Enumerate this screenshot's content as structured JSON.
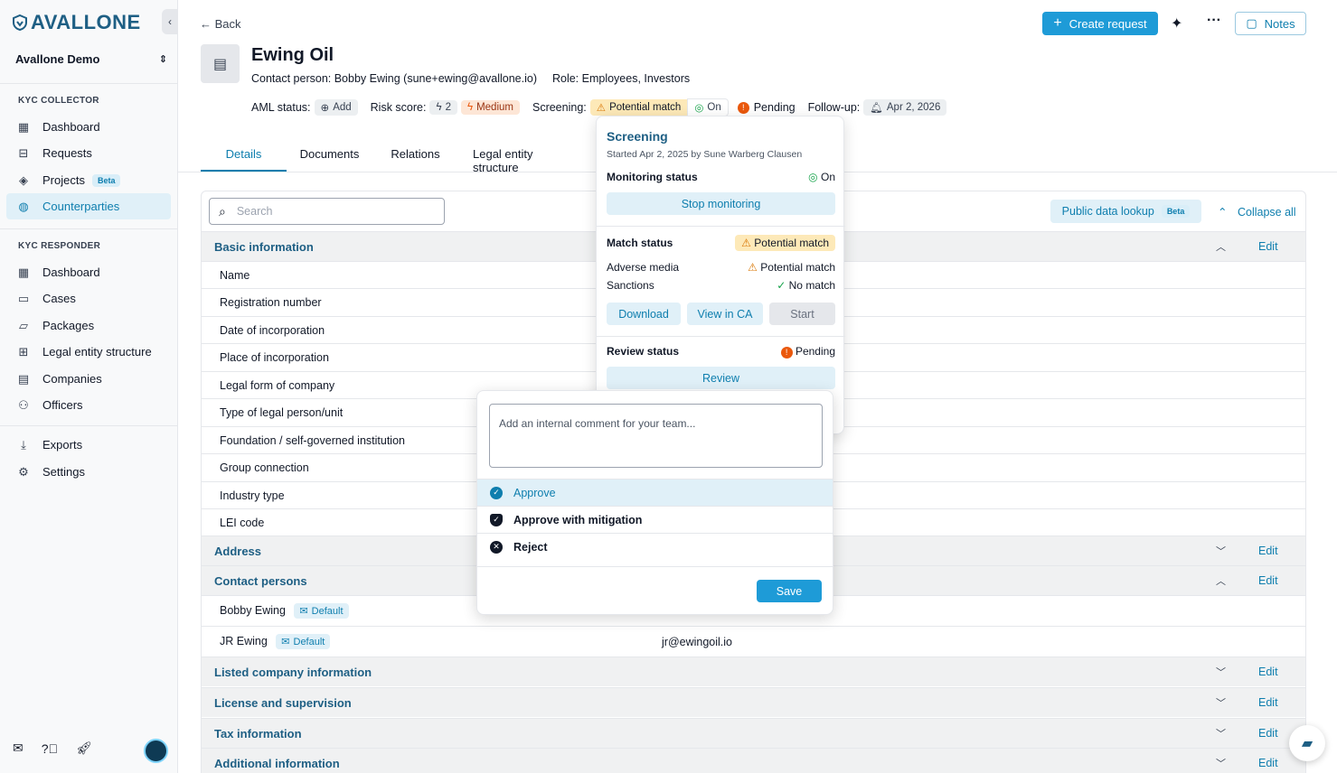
{
  "app": {
    "logo_text": "AVALLONE",
    "org_name": "Avallone Demo"
  },
  "sidebar": {
    "collector_label": "KYC COLLECTOR",
    "collector_items": [
      {
        "label": "Dashboard",
        "icon": "grid-icon"
      },
      {
        "label": "Requests",
        "icon": "inbox-icon"
      },
      {
        "label": "Projects",
        "icon": "layers-icon",
        "badge": "Beta"
      },
      {
        "label": "Counterparties",
        "icon": "globe-icon",
        "active": true
      }
    ],
    "responder_label": "KYC RESPONDER",
    "responder_items": [
      {
        "label": "Dashboard",
        "icon": "grid-icon"
      },
      {
        "label": "Cases",
        "icon": "briefcase-icon"
      },
      {
        "label": "Packages",
        "icon": "folder-icon"
      },
      {
        "label": "Legal entity structure",
        "icon": "hierarchy-icon"
      },
      {
        "label": "Companies",
        "icon": "building-icon"
      },
      {
        "label": "Officers",
        "icon": "people-icon"
      }
    ],
    "other_items": [
      {
        "label": "Exports",
        "icon": "download-icon"
      },
      {
        "label": "Settings",
        "icon": "gear-icon"
      }
    ]
  },
  "header": {
    "back_label": "Back",
    "create_request_label": "Create request",
    "notes_label": "Notes",
    "company_name": "Ewing Oil",
    "contact_person": "Contact person: Bobby Ewing (sune+ewing@avallone.io)",
    "role": "Role: Employees, Investors",
    "aml_label": "AML status:",
    "aml_value": "Add",
    "risk_label": "Risk score:",
    "risk_score": "2",
    "risk_level": "Medium",
    "screening_label": "Screening:",
    "screening_value": "Potential match",
    "monitoring_value": "On",
    "review_value": "Pending",
    "followup_label": "Follow-up:",
    "followup_date": "Apr 2, 2026"
  },
  "tabs": [
    "Details",
    "Documents",
    "Relations",
    "Legal entity structure"
  ],
  "details": {
    "search_placeholder": "Search",
    "public_lookup_label": "Public data lookup",
    "public_lookup_badge": "Beta",
    "collapse_all_label": "Collapse all",
    "edit_label": "Edit",
    "basic_information_title": "Basic information",
    "basic_fields": [
      "Name",
      "Registration number",
      "Date of incorporation",
      "Place of incorporation",
      "Legal form of company",
      "Type of legal person/unit",
      "Foundation / self-governed institution",
      "Group connection",
      "Industry type",
      "LEI code"
    ],
    "address_title": "Address",
    "contact_persons_title": "Contact persons",
    "contacts": [
      {
        "name": "Bobby Ewing",
        "badge": "Default",
        "email": ""
      },
      {
        "name": "JR Ewing",
        "badge": "Default",
        "email": "jr@ewingoil.io"
      }
    ],
    "other_sections": [
      "Listed company information",
      "License and supervision",
      "Tax information",
      "Additional information"
    ]
  },
  "screening_popover": {
    "title": "Screening",
    "subtitle": "Started Apr 2, 2025 by Sune Warberg Clausen",
    "monitoring_label": "Monitoring status",
    "monitoring_value": "On",
    "stop_monitoring_label": "Stop monitoring",
    "match_label": "Match status",
    "match_value": "Potential match",
    "adverse_media_label": "Adverse media",
    "adverse_media_value": "Potential match",
    "sanctions_label": "Sanctions",
    "sanctions_value": "No match",
    "download_label": "Download",
    "view_ca_label": "View in CA",
    "start_label": "Start",
    "review_label": "Review status",
    "review_value": "Pending",
    "review_button_label": "Review"
  },
  "review_panel": {
    "comment_placeholder": "Add an internal comment for your team...",
    "options": [
      "Approve",
      "Approve with mitigation",
      "Reject"
    ],
    "save_label": "Save"
  },
  "colors": {
    "accent": "#1e9bd7",
    "brand": "#1e5f84",
    "link": "#0e7eae"
  }
}
